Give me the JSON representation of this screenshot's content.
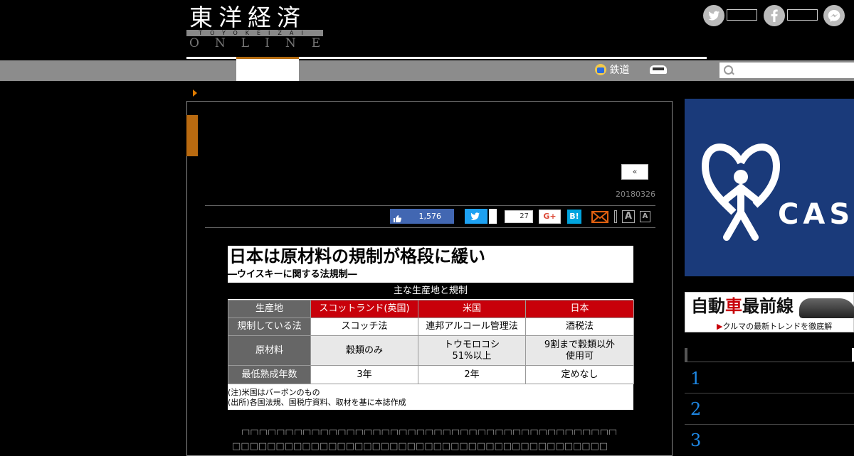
{
  "header": {
    "logo_kanji": "東洋経済",
    "logo_roman": "TOYOKEIZAI",
    "logo_online": "ONLINE"
  },
  "nav": {
    "items": [
      {
        "label": "鉄道"
      },
      {
        "label": ""
      }
    ]
  },
  "article": {
    "prev_label": "«",
    "date": "20180326",
    "share": {
      "like_count": "1,576",
      "bookmark_count": "27",
      "gplus_label": "G+",
      "hatena_label": "B!",
      "font_large": "A",
      "font_small": "A"
    },
    "figure": {
      "title": "日本は原材料の規制が格段に緩い",
      "subtitle": "―ウイスキーに関する法規制―",
      "caption": "主な生産地と規制",
      "header_row": [
        "生産地",
        "スコットランド(英国)",
        "米国",
        "日本"
      ],
      "rows": [
        {
          "label": "規制している法",
          "cells": [
            "スコッチ法",
            "連邦アルコール管理法",
            "酒税法"
          ]
        },
        {
          "label": "原材料",
          "cells": [
            "穀類のみ",
            "トウモロコシ\n51%以上",
            "9割まで穀類以外\n使用可"
          ]
        },
        {
          "label": "最低熟成年数",
          "cells": [
            "3年",
            "2年",
            "定めなし"
          ]
        }
      ],
      "notes": [
        "(注)米国はバーボンのもの",
        "(出所)各国法規、国税庁資料、取材を基に本誌作成"
      ]
    },
    "body_lines": [
      "　□□□□□□□□□□□□□□□□□□□□□□□□□□□□□□□□□□□□□□□□□□□",
      "□□□□□□□□□□□□□□□□□□□□□□□□□□□□□□□□□□□□□□□□□□□"
    ]
  },
  "sidebar": {
    "ad1_text": "CAS",
    "ad2_title_a": "自動",
    "ad2_title_b": "車",
    "ad2_title_c": "最前線",
    "ad2_sub": "クルマの最新トレンドを徹底解",
    "ranking": [
      "1",
      "2",
      "3"
    ]
  },
  "colors": {
    "accent": "#b96a10",
    "table_header_red": "#c8000a",
    "like_blue": "#4267b2",
    "twitter_blue": "#1da1f2",
    "hatena_blue": "#00a4de",
    "rank_blue": "#1e88e5"
  },
  "icons": [
    "twitter-icon",
    "facebook-icon",
    "messenger-icon",
    "train-icon",
    "car-icon",
    "search-icon",
    "like-icon",
    "mail-icon",
    "print-icon"
  ]
}
